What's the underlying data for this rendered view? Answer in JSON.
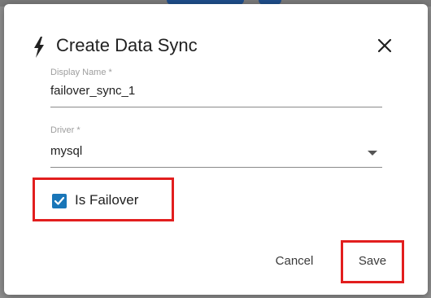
{
  "dialog": {
    "title": "Create Data Sync",
    "title_icon": "lightning-bolt-icon",
    "close_icon": "close-icon"
  },
  "fields": {
    "display_name": {
      "label": "Display Name *",
      "value": "failover_sync_1"
    },
    "driver": {
      "label": "Driver *",
      "value": "mysql",
      "arrow_icon": "dropdown-arrow-icon"
    }
  },
  "is_failover": {
    "label": "Is Failover",
    "checked": true
  },
  "actions": {
    "cancel_label": "Cancel",
    "save_label": "Save"
  },
  "colors": {
    "checkbox": "#1976b8",
    "highlight": "#e21e1e",
    "backdrop": "#8e8e8e"
  }
}
